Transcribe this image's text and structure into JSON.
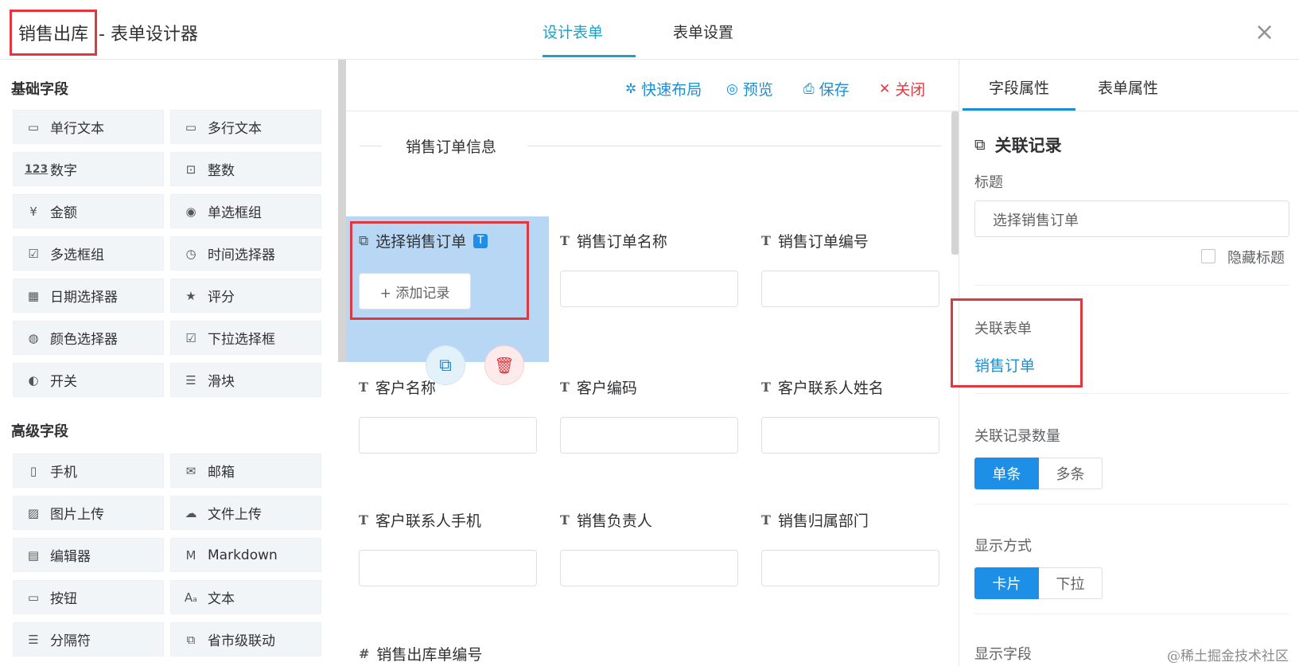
{
  "header": {
    "title_highlight": "销售出库",
    "title_rest": "- 表单设计器",
    "tabs": [
      "设计表单",
      "表单设置"
    ],
    "close_glyph": "×"
  },
  "left_panel": {
    "basic_title": "基础字段",
    "basic_items": [
      {
        "label": "单行文本",
        "icon": "single-line-text-icon",
        "glyph": "▭"
      },
      {
        "label": "多行文本",
        "icon": "multi-line-text-icon",
        "glyph": "▭"
      },
      {
        "label": "数字",
        "icon": "number-icon",
        "glyph": "123"
      },
      {
        "label": "整数",
        "icon": "integer-icon",
        "glyph": "⊡"
      },
      {
        "label": "金额",
        "icon": "amount-icon",
        "glyph": "¥"
      },
      {
        "label": "单选框组",
        "icon": "radio-icon",
        "glyph": "◉"
      },
      {
        "label": "多选框组",
        "icon": "checkbox-icon",
        "glyph": "☑"
      },
      {
        "label": "时间选择器",
        "icon": "clock-icon",
        "glyph": "◷"
      },
      {
        "label": "日期选择器",
        "icon": "calendar-icon",
        "glyph": "▦"
      },
      {
        "label": "评分",
        "icon": "star-icon",
        "glyph": "★"
      },
      {
        "label": "颜色选择器",
        "icon": "palette-icon",
        "glyph": "◍"
      },
      {
        "label": "下拉选择框",
        "icon": "select-icon",
        "glyph": "☑"
      },
      {
        "label": "开关",
        "icon": "toggle-icon",
        "glyph": "◐"
      },
      {
        "label": "滑块",
        "icon": "slider-icon",
        "glyph": "☰"
      }
    ],
    "advanced_title": "高级字段",
    "advanced_items": [
      {
        "label": "手机",
        "icon": "phone-icon",
        "glyph": "▯"
      },
      {
        "label": "邮箱",
        "icon": "mail-icon",
        "glyph": "✉"
      },
      {
        "label": "图片上传",
        "icon": "image-icon",
        "glyph": "▨"
      },
      {
        "label": "文件上传",
        "icon": "upload-icon",
        "glyph": "☁"
      },
      {
        "label": "编辑器",
        "icon": "editor-icon",
        "glyph": "▤"
      },
      {
        "label": "Markdown",
        "icon": "markdown-icon",
        "glyph": "M"
      },
      {
        "label": "按钮",
        "icon": "button-icon",
        "glyph": "▭"
      },
      {
        "label": "文本",
        "icon": "text-icon",
        "glyph": "Aₐ"
      },
      {
        "label": "分隔符",
        "icon": "divider-icon",
        "glyph": "☰"
      },
      {
        "label": "省市级联动",
        "icon": "cascade-icon",
        "glyph": "⧉"
      }
    ]
  },
  "toolbar": {
    "quick_layout": "快速布局",
    "preview": "预览",
    "save": "保存",
    "close": "关闭"
  },
  "canvas": {
    "section_title": "销售订单信息",
    "selected_field": {
      "label": "选择销售订单",
      "badge": "T",
      "add_button": "+ 添加记录"
    },
    "fields": [
      "销售订单名称",
      "销售订单编号",
      "客户名称",
      "客户编码",
      "客户联系人姓名",
      "客户联系人手机",
      "销售负责人",
      "销售归属部门",
      "销售出库单编号"
    ],
    "field_glyph": "T",
    "number_glyph": "#"
  },
  "right_panel": {
    "tabs": [
      "字段属性",
      "表单属性"
    ],
    "section_title": "关联记录",
    "title_label": "标题",
    "title_value": "选择销售订单",
    "hide_title_label": "隐藏标题",
    "linked_form_label": "关联表单",
    "linked_form_value": "销售订单",
    "record_count_label": "关联记录数量",
    "record_count_options": [
      "单条",
      "多条"
    ],
    "display_mode_label": "显示方式",
    "display_mode_options": [
      "卡片",
      "下拉"
    ],
    "display_fields_label": "显示字段"
  },
  "watermark": "@稀土掘金技术社区",
  "colors": {
    "accent": "#1aa3c8",
    "primary": "#1e8fe6",
    "danger": "#e0383e",
    "selected_bg": "#b8d7f5"
  }
}
